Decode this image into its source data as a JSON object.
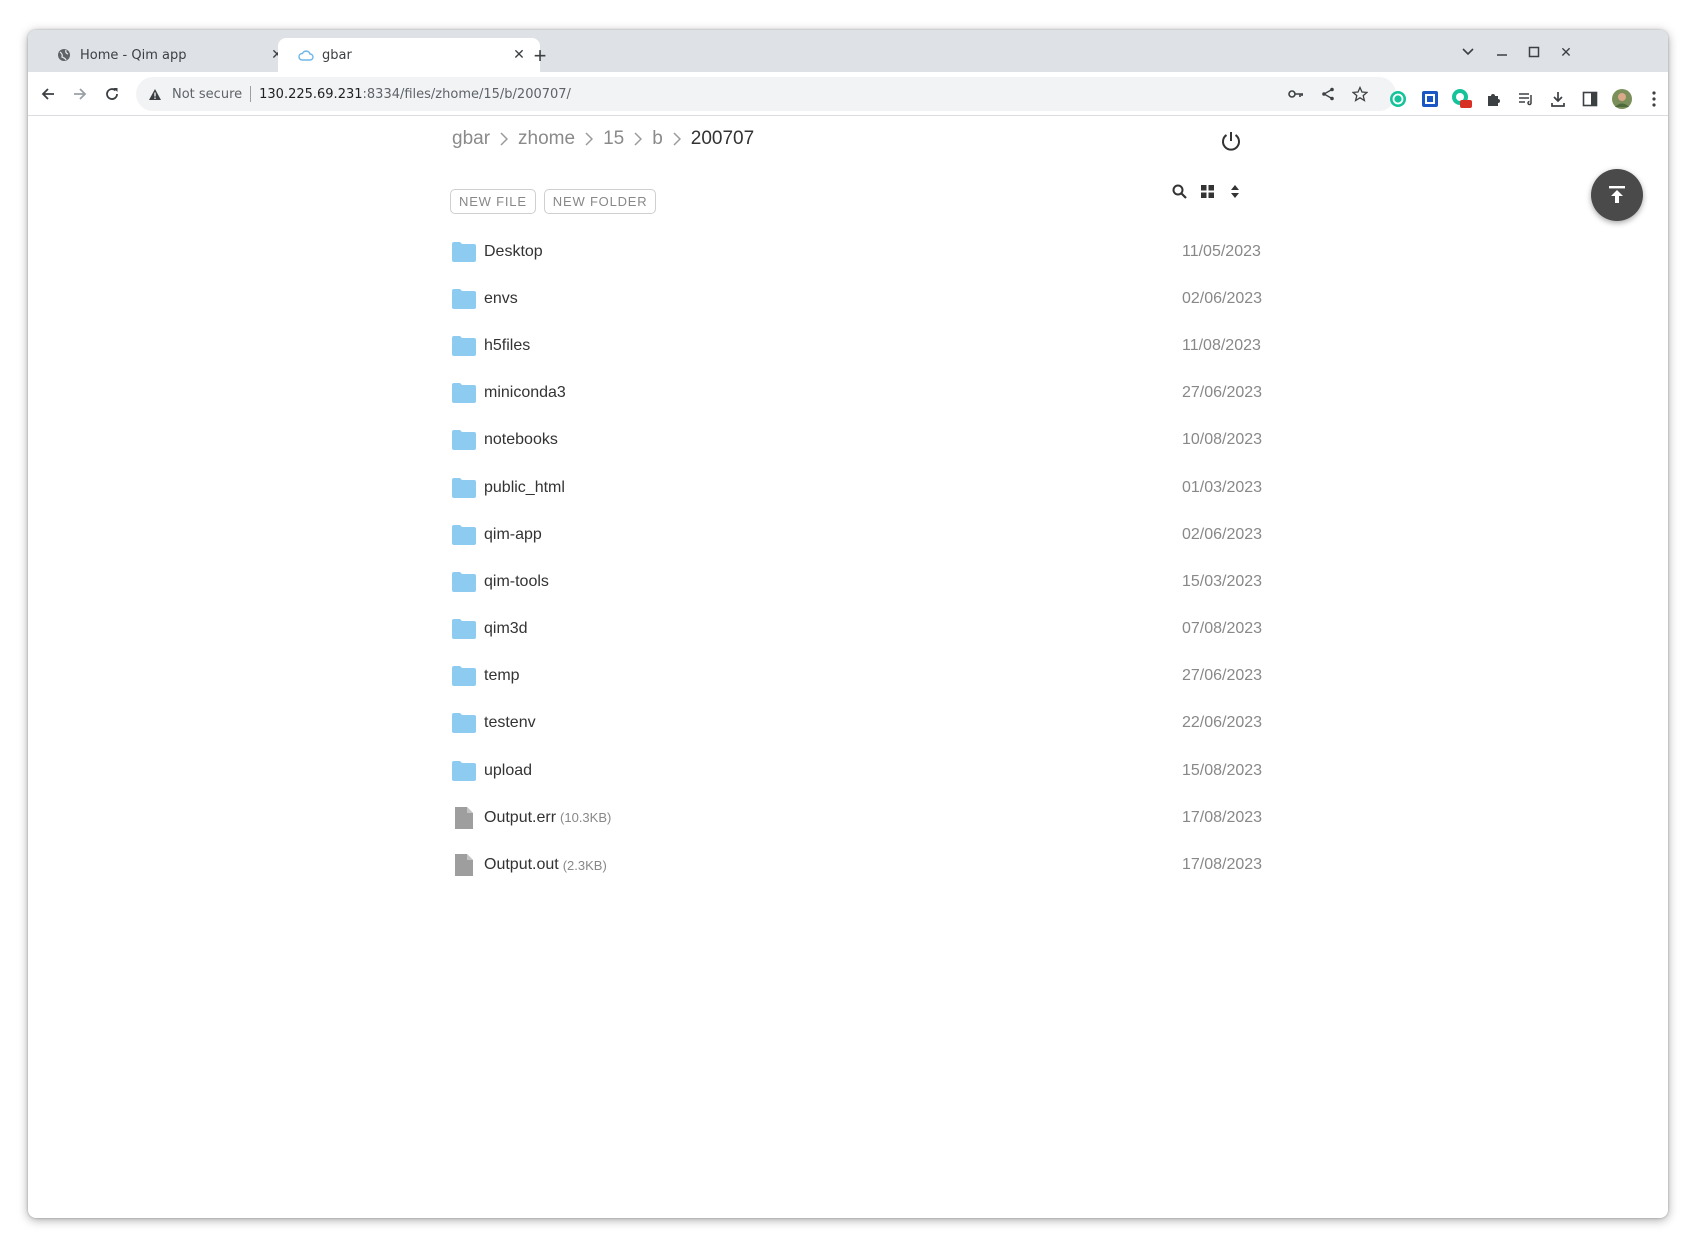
{
  "browser": {
    "tabs": [
      {
        "title": "Home - Qim app",
        "active": false,
        "favicon": "globe-icon"
      },
      {
        "title": "gbar",
        "active": true,
        "favicon": "cloud-icon"
      }
    ],
    "omnibox": {
      "security_label": "Not secure",
      "host": "130.225.69.231",
      "path": ":8334/files/zhome/15/b/200707/"
    }
  },
  "page": {
    "breadcrumb": [
      "gbar",
      "zhome",
      "15",
      "b",
      "200707"
    ],
    "actions": {
      "new_file": "NEW FILE",
      "new_folder": "NEW FOLDER"
    },
    "files": [
      {
        "name": "Desktop",
        "type": "folder",
        "date": "11/05/2023"
      },
      {
        "name": "envs",
        "type": "folder",
        "date": "02/06/2023"
      },
      {
        "name": "h5files",
        "type": "folder",
        "date": "11/08/2023"
      },
      {
        "name": "miniconda3",
        "type": "folder",
        "date": "27/06/2023"
      },
      {
        "name": "notebooks",
        "type": "folder",
        "date": "10/08/2023"
      },
      {
        "name": "public_html",
        "type": "folder",
        "date": "01/03/2023"
      },
      {
        "name": "qim-app",
        "type": "folder",
        "date": "02/06/2023"
      },
      {
        "name": "qim-tools",
        "type": "folder",
        "date": "15/03/2023"
      },
      {
        "name": "qim3d",
        "type": "folder",
        "date": "07/08/2023"
      },
      {
        "name": "temp",
        "type": "folder",
        "date": "27/06/2023"
      },
      {
        "name": "testenv",
        "type": "folder",
        "date": "22/06/2023"
      },
      {
        "name": "upload",
        "type": "folder",
        "date": "15/08/2023"
      },
      {
        "name": "Output.err",
        "type": "file",
        "size": "(10.3KB)",
        "date": "17/08/2023"
      },
      {
        "name": "Output.out",
        "type": "file",
        "size": "(2.3KB)",
        "date": "17/08/2023"
      }
    ]
  },
  "colors": {
    "folder": "#8ecbf0",
    "file": "#9e9e9e",
    "fab": "#4a4a4a"
  }
}
